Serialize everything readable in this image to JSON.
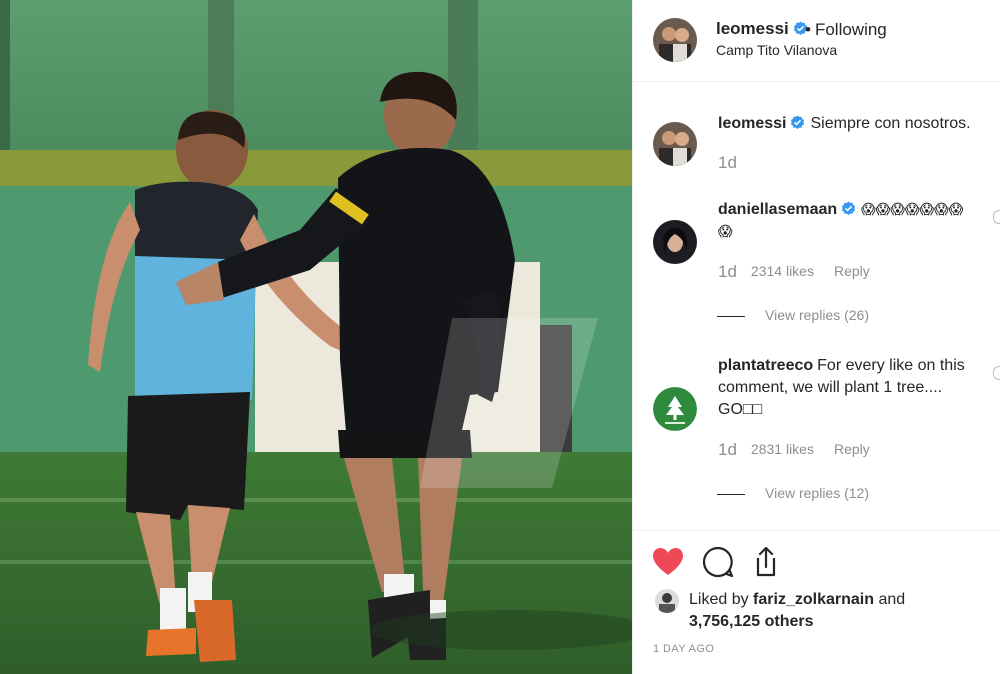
{
  "post": {
    "username": "leomessi",
    "follow_separator": "•",
    "follow_status": "Following",
    "location": "Camp Tito Vilanova"
  },
  "comments": [
    {
      "username": "leomessi",
      "verified": true,
      "text": "Siempre con nosotros.",
      "time": "1d"
    },
    {
      "username": "daniellasemaan",
      "verified": true,
      "text": "😱😱😱😱😱😱😱😱",
      "time": "1d",
      "likes": "2314 likes",
      "reply_label": "Reply",
      "view_replies": "View replies (26)"
    },
    {
      "username": "plantatreeco",
      "verified": false,
      "text": "For every like on this comment, we will plant 1 tree.... GO□□",
      "time": "1d",
      "likes": "2831 likes",
      "reply_label": "Reply",
      "view_replies": "View replies (12)"
    }
  ],
  "actions": {
    "like_icon": "heart-filled-icon",
    "comment_icon": "comment-bubble-icon",
    "share_icon": "share-upload-icon"
  },
  "liked_by": {
    "prefix": "Liked by",
    "user": "fariz_zolkarnain",
    "conjunction": "and",
    "others": "3,756,125 others"
  },
  "timestamp": "1 DAY AGO",
  "colors": {
    "verified_blue": "#3897f0",
    "heart_red": "#ed4956",
    "text_primary": "#262626",
    "text_secondary": "#8e8e8e"
  }
}
